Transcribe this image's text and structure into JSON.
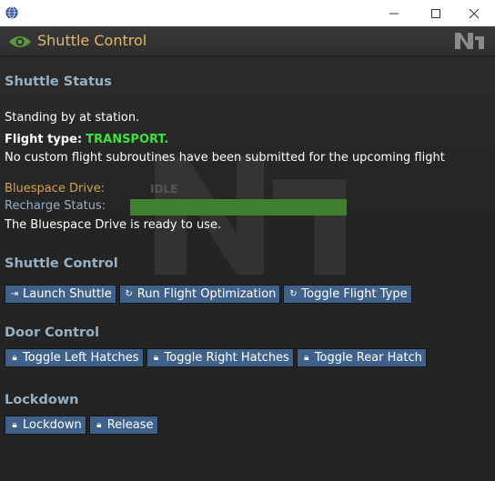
{
  "window": {
    "icon": "globe-icon",
    "controls": [
      "minimize-icon",
      "maximize-icon",
      "close-icon"
    ]
  },
  "titlebar": {
    "title": "Shuttle Control",
    "icon": "eye-icon",
    "logo": "nanotrasen-logo"
  },
  "status": {
    "heading": "Shuttle Status",
    "standby": "Standing by at station.",
    "flight_type_label": "Flight type:",
    "flight_type_value": "TRANSPORT.",
    "subroutines": "No custom flight subroutines have been submitted for the upcoming flight",
    "drive_label": "Bluespace Drive:",
    "drive_value": "IDLE",
    "recharge_label": "Recharge Status:",
    "recharge_fraction": 1.0,
    "ready": "The Bluespace Drive is ready to use."
  },
  "shuttle_control": {
    "heading": "Shuttle Control",
    "buttons": [
      {
        "label": "Launch Shuttle",
        "icon": "launch-icon"
      },
      {
        "label": "Run Flight Optimization",
        "icon": "refresh-icon"
      },
      {
        "label": "Toggle Flight Type",
        "icon": "refresh-icon"
      }
    ]
  },
  "door_control": {
    "heading": "Door Control",
    "buttons": [
      {
        "label": "Toggle Left Hatches",
        "icon": "lock-icon"
      },
      {
        "label": "Toggle Right Hatches",
        "icon": "lock-icon"
      },
      {
        "label": "Toggle Rear Hatch",
        "icon": "lock-icon"
      }
    ]
  },
  "lockdown": {
    "heading": "Lockdown",
    "buttons": [
      {
        "label": "Lockdown",
        "icon": "lock-icon"
      },
      {
        "label": "Release",
        "icon": "lock-icon"
      }
    ]
  },
  "colors": {
    "title": "#e0b66c",
    "heading": "#98b0c3",
    "button": "#40628a",
    "flight_type": "#40e040",
    "recharge_bar": "#3f7f2f"
  }
}
